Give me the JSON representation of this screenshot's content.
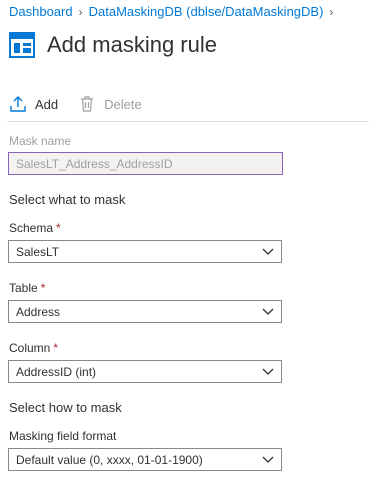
{
  "breadcrumb": {
    "items": [
      "Dashboard",
      "DataMaskingDB (dblse/DataMaskingDB)"
    ]
  },
  "page": {
    "title": "Add masking rule"
  },
  "toolbar": {
    "add_label": "Add",
    "delete_label": "Delete"
  },
  "form": {
    "mask_name": {
      "label": "Mask name",
      "value": "SalesLT_Address_AddressID"
    },
    "section_what": "Select what to mask",
    "schema": {
      "label": "Schema",
      "required": "*",
      "value": "SalesLT"
    },
    "table": {
      "label": "Table",
      "required": "*",
      "value": "Address"
    },
    "column": {
      "label": "Column",
      "required": "*",
      "value": "AddressID (int)"
    },
    "section_how": "Select how to mask",
    "masking_format": {
      "label": "Masking field format",
      "value": "Default value (0, xxxx, 01-01-1900)"
    }
  },
  "colors": {
    "accent": "#0078d4",
    "required": "#a4262c",
    "focus_border": "#8764b8"
  }
}
